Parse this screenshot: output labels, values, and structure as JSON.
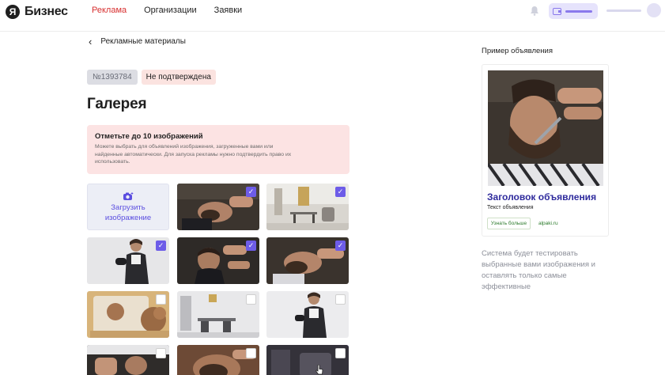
{
  "header": {
    "logo_mark": "Я",
    "logo_text": "Бизнес",
    "nav": [
      {
        "label": "Реклама",
        "active": true
      },
      {
        "label": "Организации",
        "active": false
      },
      {
        "label": "Заявки",
        "active": false
      }
    ],
    "icons": {
      "bell": "bell-icon",
      "wallet": "wallet-icon"
    }
  },
  "breadcrumb": {
    "back_label": "Рекламные материалы",
    "arrow": "‹"
  },
  "badges": {
    "id": "№1393784",
    "status": "Не подтверждена"
  },
  "page_title": "Галерея",
  "notice": {
    "title": "Отметьте до 10 изображений",
    "text": "Можете выбрать для объявлений изображения, загруженные вами или найденные автоматически. Для запуска рекламы нужно подтвердить право их использовать."
  },
  "gallery": {
    "upload_label_line1": "Загрузить",
    "upload_label_line2": "изображение",
    "check_glyph": "✓",
    "tiles": [
      {
        "subject": "barber-trimming-beard",
        "checked": true
      },
      {
        "subject": "salon-interior",
        "checked": true
      },
      {
        "subject": "stylist-with-hairdryer",
        "checked": true
      },
      {
        "subject": "barber-cutting-hair",
        "checked": true
      },
      {
        "subject": "barber-shaving-beard",
        "checked": true
      },
      {
        "subject": "woman-curly-hair-mirror",
        "checked": false
      },
      {
        "subject": "salon-hall",
        "checked": false
      },
      {
        "subject": "stylist-portrait",
        "checked": false
      },
      {
        "subject": "barber-client-dark",
        "checked": false
      },
      {
        "subject": "beard-grooming-closeup",
        "checked": false
      },
      {
        "subject": "barber-chair-dark",
        "checked": false,
        "hovered": true
      }
    ]
  },
  "preview": {
    "title": "Пример объявления",
    "ad_heading": "Заголовок объявления",
    "ad_text": "Текст объявления",
    "button_label": "Узнать больше",
    "domain": "alpaki.ru"
  },
  "system_note": "Система будет тестировать выбранные вами изображения и оставлять только самые эффективные",
  "colors": {
    "accent": "#6d5ce8",
    "nav_active": "#d72f2f",
    "notice_bg": "#fce3e3",
    "ad_heading": "#2f2b9d",
    "link_green": "#2b7a2b"
  }
}
